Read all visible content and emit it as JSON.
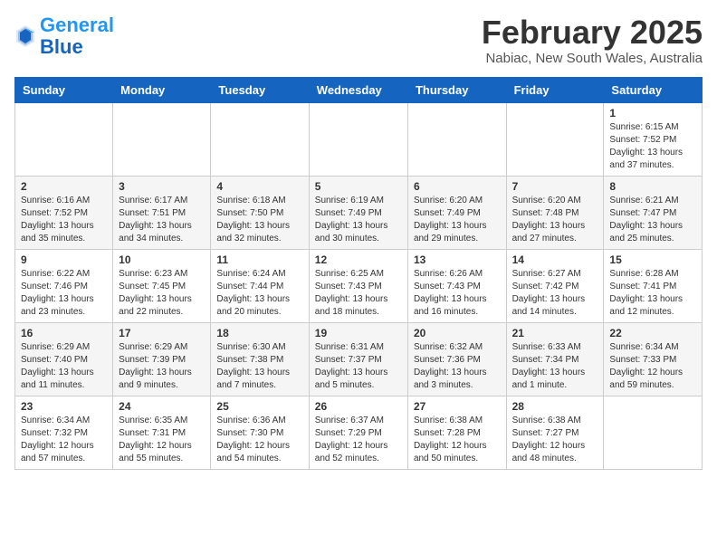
{
  "header": {
    "logo_general": "General",
    "logo_blue": "Blue",
    "month_year": "February 2025",
    "location": "Nabiac, New South Wales, Australia"
  },
  "weekdays": [
    "Sunday",
    "Monday",
    "Tuesday",
    "Wednesday",
    "Thursday",
    "Friday",
    "Saturday"
  ],
  "weeks": [
    [
      {
        "day": "",
        "info": ""
      },
      {
        "day": "",
        "info": ""
      },
      {
        "day": "",
        "info": ""
      },
      {
        "day": "",
        "info": ""
      },
      {
        "day": "",
        "info": ""
      },
      {
        "day": "",
        "info": ""
      },
      {
        "day": "1",
        "info": "Sunrise: 6:15 AM\nSunset: 7:52 PM\nDaylight: 13 hours\nand 37 minutes."
      }
    ],
    [
      {
        "day": "2",
        "info": "Sunrise: 6:16 AM\nSunset: 7:52 PM\nDaylight: 13 hours\nand 35 minutes."
      },
      {
        "day": "3",
        "info": "Sunrise: 6:17 AM\nSunset: 7:51 PM\nDaylight: 13 hours\nand 34 minutes."
      },
      {
        "day": "4",
        "info": "Sunrise: 6:18 AM\nSunset: 7:50 PM\nDaylight: 13 hours\nand 32 minutes."
      },
      {
        "day": "5",
        "info": "Sunrise: 6:19 AM\nSunset: 7:49 PM\nDaylight: 13 hours\nand 30 minutes."
      },
      {
        "day": "6",
        "info": "Sunrise: 6:20 AM\nSunset: 7:49 PM\nDaylight: 13 hours\nand 29 minutes."
      },
      {
        "day": "7",
        "info": "Sunrise: 6:20 AM\nSunset: 7:48 PM\nDaylight: 13 hours\nand 27 minutes."
      },
      {
        "day": "8",
        "info": "Sunrise: 6:21 AM\nSunset: 7:47 PM\nDaylight: 13 hours\nand 25 minutes."
      }
    ],
    [
      {
        "day": "9",
        "info": "Sunrise: 6:22 AM\nSunset: 7:46 PM\nDaylight: 13 hours\nand 23 minutes."
      },
      {
        "day": "10",
        "info": "Sunrise: 6:23 AM\nSunset: 7:45 PM\nDaylight: 13 hours\nand 22 minutes."
      },
      {
        "day": "11",
        "info": "Sunrise: 6:24 AM\nSunset: 7:44 PM\nDaylight: 13 hours\nand 20 minutes."
      },
      {
        "day": "12",
        "info": "Sunrise: 6:25 AM\nSunset: 7:43 PM\nDaylight: 13 hours\nand 18 minutes."
      },
      {
        "day": "13",
        "info": "Sunrise: 6:26 AM\nSunset: 7:43 PM\nDaylight: 13 hours\nand 16 minutes."
      },
      {
        "day": "14",
        "info": "Sunrise: 6:27 AM\nSunset: 7:42 PM\nDaylight: 13 hours\nand 14 minutes."
      },
      {
        "day": "15",
        "info": "Sunrise: 6:28 AM\nSunset: 7:41 PM\nDaylight: 13 hours\nand 12 minutes."
      }
    ],
    [
      {
        "day": "16",
        "info": "Sunrise: 6:29 AM\nSunset: 7:40 PM\nDaylight: 13 hours\nand 11 minutes."
      },
      {
        "day": "17",
        "info": "Sunrise: 6:29 AM\nSunset: 7:39 PM\nDaylight: 13 hours\nand 9 minutes."
      },
      {
        "day": "18",
        "info": "Sunrise: 6:30 AM\nSunset: 7:38 PM\nDaylight: 13 hours\nand 7 minutes."
      },
      {
        "day": "19",
        "info": "Sunrise: 6:31 AM\nSunset: 7:37 PM\nDaylight: 13 hours\nand 5 minutes."
      },
      {
        "day": "20",
        "info": "Sunrise: 6:32 AM\nSunset: 7:36 PM\nDaylight: 13 hours\nand 3 minutes."
      },
      {
        "day": "21",
        "info": "Sunrise: 6:33 AM\nSunset: 7:34 PM\nDaylight: 13 hours\nand 1 minute."
      },
      {
        "day": "22",
        "info": "Sunrise: 6:34 AM\nSunset: 7:33 PM\nDaylight: 12 hours\nand 59 minutes."
      }
    ],
    [
      {
        "day": "23",
        "info": "Sunrise: 6:34 AM\nSunset: 7:32 PM\nDaylight: 12 hours\nand 57 minutes."
      },
      {
        "day": "24",
        "info": "Sunrise: 6:35 AM\nSunset: 7:31 PM\nDaylight: 12 hours\nand 55 minutes."
      },
      {
        "day": "25",
        "info": "Sunrise: 6:36 AM\nSunset: 7:30 PM\nDaylight: 12 hours\nand 54 minutes."
      },
      {
        "day": "26",
        "info": "Sunrise: 6:37 AM\nSunset: 7:29 PM\nDaylight: 12 hours\nand 52 minutes."
      },
      {
        "day": "27",
        "info": "Sunrise: 6:38 AM\nSunset: 7:28 PM\nDaylight: 12 hours\nand 50 minutes."
      },
      {
        "day": "28",
        "info": "Sunrise: 6:38 AM\nSunset: 7:27 PM\nDaylight: 12 hours\nand 48 minutes."
      },
      {
        "day": "",
        "info": ""
      }
    ]
  ]
}
